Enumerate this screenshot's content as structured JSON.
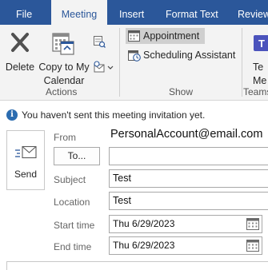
{
  "tabs": [
    "File",
    "Meeting",
    "Insert",
    "Format Text",
    "Review"
  ],
  "ribbon": {
    "actions": {
      "delete_label": "Delete",
      "copy_label_line1": "Copy to My",
      "copy_label_line2": "Calendar",
      "group_label": "Actions"
    },
    "show": {
      "appointment_label": "Appointment",
      "scheduling_label": "Scheduling Assistant",
      "group_label": "Show"
    },
    "teams": {
      "label_line1": "Te",
      "label_line2": "Me",
      "group_label": "Teams"
    }
  },
  "infobar": {
    "message": "You haven't sent this meeting invitation yet."
  },
  "form": {
    "send_label": "Send",
    "from_label": "From",
    "from_value": "PersonalAccount@email.com",
    "to_button": "To...",
    "to_value": "",
    "subject_label": "Subject",
    "subject_value": "Test",
    "location_label": "Location",
    "location_value": "Test",
    "start_label": "Start time",
    "start_date": "Thu 6/29/2023",
    "end_label": "End time",
    "end_date": "Thu 6/29/2023"
  }
}
